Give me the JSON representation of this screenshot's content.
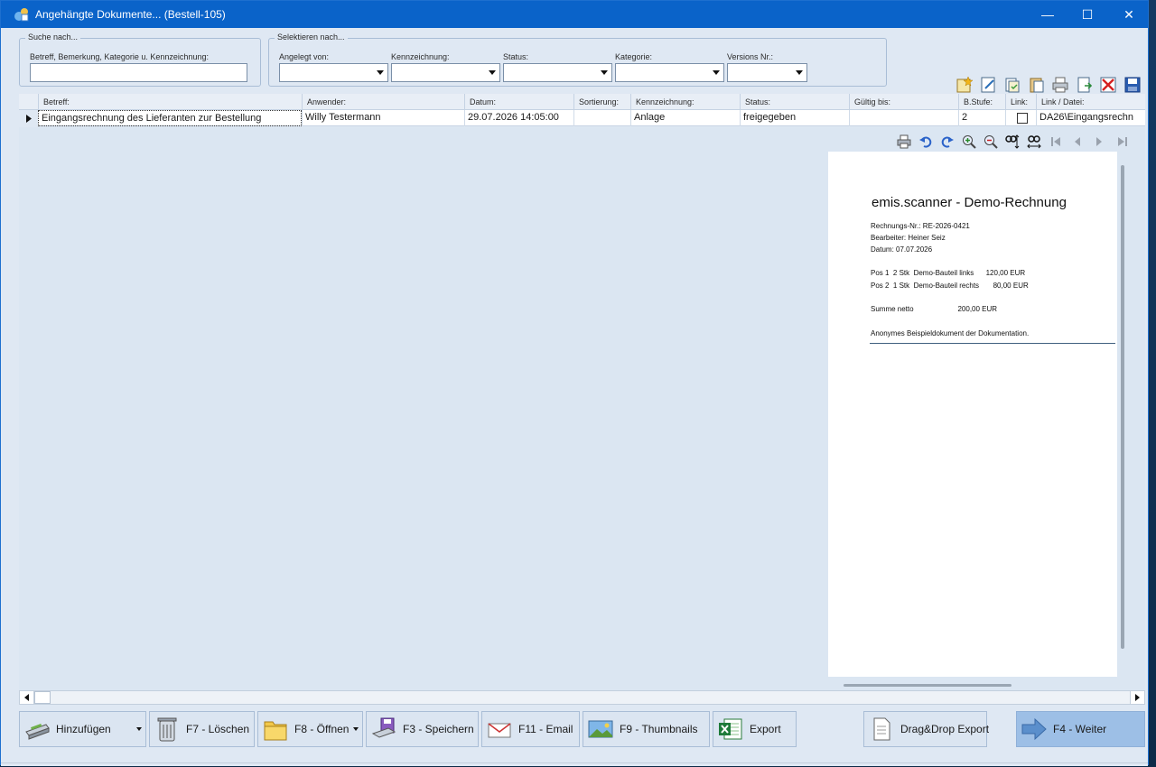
{
  "window": {
    "title": "Angehängte Dokumente... (Bestell-105)",
    "controls": {
      "minimize": "—",
      "maximize": "☐",
      "close": "✕"
    }
  },
  "search": {
    "group_label": "Suche nach...",
    "field_label": "Betreff, Bemerkung, Kategorie u. Kennzeichnung:",
    "value": ""
  },
  "select": {
    "group_label": "Selektieren nach...",
    "filters": [
      {
        "label": "Angelegt von:",
        "value": ""
      },
      {
        "label": "Kennzeichnung:",
        "value": ""
      },
      {
        "label": "Status:",
        "value": ""
      },
      {
        "label": "Kategorie:",
        "value": ""
      },
      {
        "label": "Versions Nr.:",
        "value": ""
      }
    ]
  },
  "toolbar_icons": [
    "new-star-icon",
    "edit-icon",
    "copy-icon",
    "paste-icon",
    "print-icon",
    "save-as-icon",
    "delete-icon",
    "save-icon"
  ],
  "grid": {
    "columns": [
      "Betreff:",
      "Anwender:",
      "Datum:",
      "Sortierung:",
      "Kennzeichnung:",
      "Status:",
      "Gültig bis:",
      "B.Stufe:",
      "Link:",
      "Link / Datei:"
    ],
    "rows": [
      {
        "betreff": "Eingangsrechnung des Lieferanten zur Bestellung",
        "anwender": "Willy Testermann",
        "datum": "29.07.2026 14:05:00",
        "sortierung": "",
        "kennzeichnung": "Anlage",
        "status": "freigegeben",
        "gueltig_bis": "",
        "bstufe": "2",
        "link_checked": false,
        "datei": "DA26\\Eingangsrechn"
      }
    ]
  },
  "viewer_toolbar": [
    "print-icon",
    "rotate-left-icon",
    "rotate-right-icon",
    "zoom-in-icon",
    "zoom-out-icon",
    "fit-height-icon",
    "fit-width-icon",
    "first-page-icon",
    "prev-page-icon",
    "next-page-icon",
    "last-page-icon"
  ],
  "document": {
    "title": "emis.scanner - Demo-Rechnung",
    "lines": [
      "Rechnungs-Nr.: RE-2026-0421",
      "Bearbeiter: Heiner Seiz",
      "Datum: 07.07.2026",
      "Pos 1  2 Stk  Demo-Bauteil links      120,00 EUR",
      "Pos 2  1 Stk  Demo-Bauteil rechts       80,00 EUR",
      "Summe netto                      200,00 EUR",
      "Anonymes Beispieldokument der Dokumentation."
    ]
  },
  "buttons": {
    "add": "Hinzufügen",
    "delete": "F7 - Löschen",
    "open": "F8 - Öffnen",
    "save": "F3 - Speichern",
    "email": "F11 - Email",
    "thumbnails": "F9 - Thumbnails",
    "export": "Export",
    "dragdrop": "Drag&Drop Export",
    "next": "F4 - Weiter"
  },
  "colors": {
    "titlebar": "#0a63c9",
    "client": "#dfe8f3",
    "primary_button": "#9dbfe6"
  }
}
